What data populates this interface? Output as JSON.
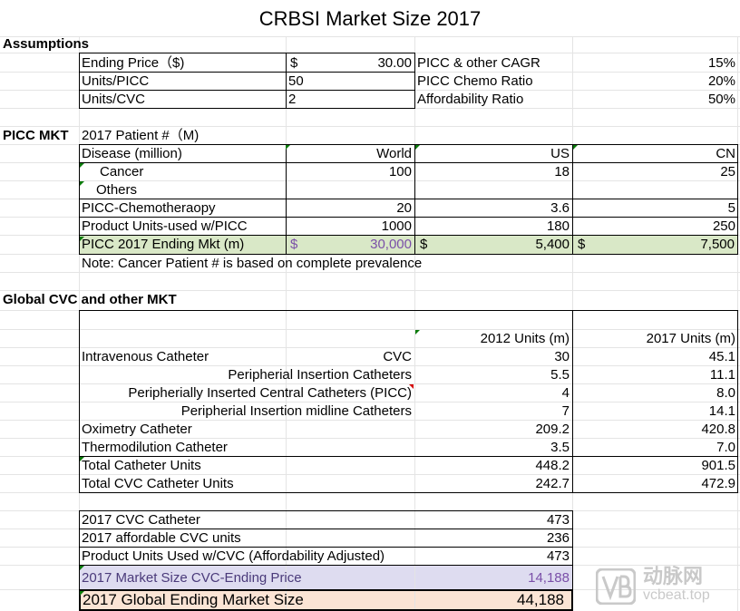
{
  "title": "CRBSI Market Size 2017",
  "assumptions": {
    "heading": "Assumptions",
    "ending_price_label": "Ending Price（$)",
    "ending_price_currency": "$",
    "ending_price_value": "30.00",
    "picc_cagr_label": "PICC & other CAGR",
    "picc_cagr_value": "15%",
    "units_picc_label": "Units/PICC",
    "units_picc_value": "50",
    "picc_chemo_label": "PICC Chemo Ratio",
    "picc_chemo_value": "20%",
    "units_cvc_label": "Units/CVC",
    "units_cvc_value": "2",
    "affordability_label": "Affordability Ratio",
    "affordability_value": "50%"
  },
  "picc": {
    "heading": "PICC MKT",
    "subheading": "2017 Patient #（M)",
    "headers": [
      "Disease (million)",
      "World",
      "US",
      "CN"
    ],
    "rows": [
      {
        "label": "Cancer",
        "world": "100",
        "us": "18",
        "cn": "25"
      },
      {
        "label": "Others",
        "world": "",
        "us": "",
        "cn": ""
      },
      {
        "label": "PICC-Chemotheraopy",
        "world": "20",
        "us": "3.6",
        "cn": "5"
      },
      {
        "label": "Product Units-used w/PICC",
        "world": "1000",
        "us": "180",
        "cn": "250"
      }
    ],
    "ending": {
      "label": "PICC 2017 Ending Mkt (m)",
      "currency": "$",
      "world": "30,000",
      "us": "5,400",
      "cn": "7,500"
    },
    "note": "Note:   Cancer Patient # is based on complete prevalence"
  },
  "cvc": {
    "heading": "Global CVC and other MKT",
    "header_2012": "2012 Units (m)",
    "header_2017": "2017 Units (m)",
    "rows": [
      {
        "label": "Intravenous Catheter",
        "type": "CVC",
        "u2012": "30",
        "u2017": "45.1"
      },
      {
        "label": "Peripherial Insertion Catheters",
        "u2012": "5.5",
        "u2017": "11.1"
      },
      {
        "label": "Peripherially Inserted Central Catheters (PICC)",
        "u2012": "4",
        "u2017": "8.0"
      },
      {
        "label": "Peripherial Insertion midline Catheters",
        "u2012": "7",
        "u2017": "14.1"
      },
      {
        "label": "Oximetry Catheter",
        "u2012": "209.2",
        "u2017": "420.8"
      },
      {
        "label": "Thermodilution Catheter",
        "u2012": "3.5",
        "u2017": "7.0"
      },
      {
        "label": "Total Catheter Units",
        "u2012": "448.2",
        "u2017": "901.5"
      },
      {
        "label": "Total CVC Catheter Units",
        "u2012": "242.7",
        "u2017": "472.9"
      }
    ]
  },
  "summary": {
    "rows": [
      {
        "label": "2017 CVC Catheter",
        "value": "473"
      },
      {
        "label": "2017 affordable CVC units",
        "value": "236"
      },
      {
        "label": "Product Units Used w/CVC (Affordability Adjusted)",
        "value": "473"
      }
    ],
    "cvc_ending": {
      "label": "2017 Market Size CVC-Ending Price",
      "value": "14,188"
    },
    "global": {
      "label": "2017 Global Ending Market Size",
      "value": "44,188"
    }
  },
  "watermark": {
    "cn": "动脉网",
    "en": "vcbeat.top"
  },
  "colors": {
    "picc_highlight": "#d9e8c7",
    "cvc_highlight": "#dedcf0",
    "global_highlight": "#fbe4d5",
    "purple_value": "#7a4fa8",
    "comment_marker": "#0a7a0a"
  }
}
